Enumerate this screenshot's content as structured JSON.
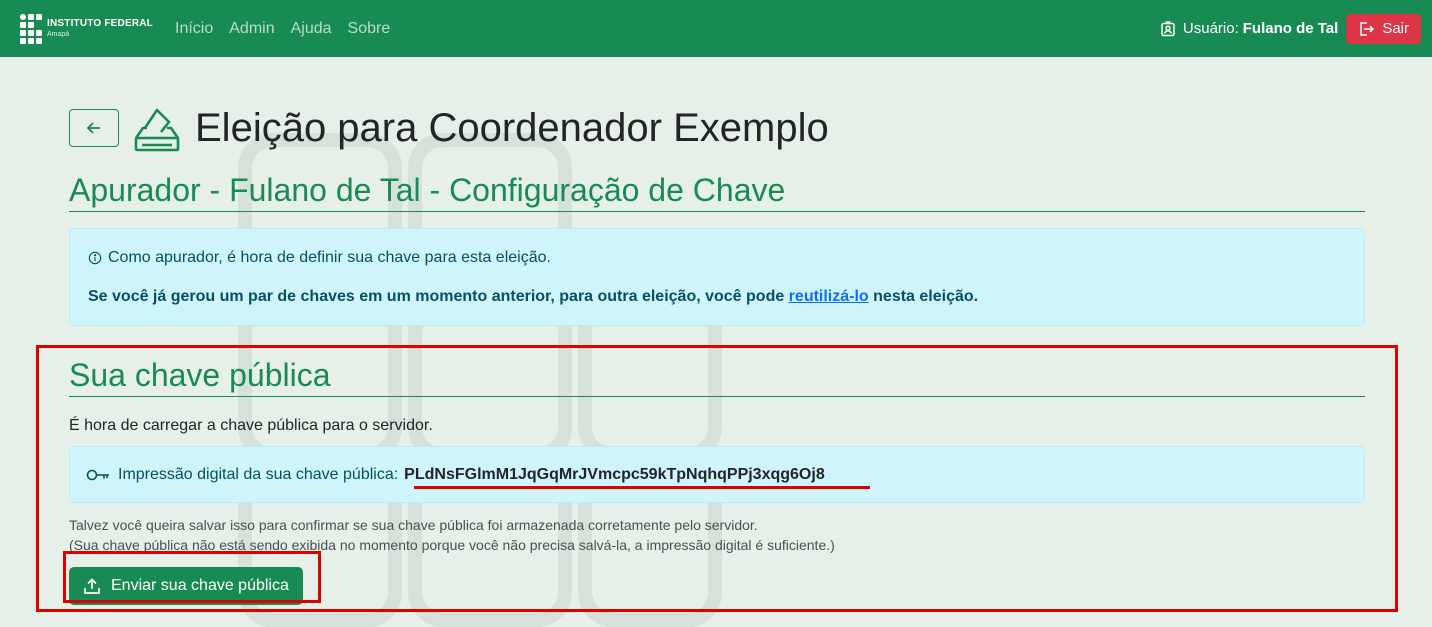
{
  "navbar": {
    "brand_name": "INSTITUTO FEDERAL",
    "brand_sub": "Amapá",
    "links": [
      "Início",
      "Admin",
      "Ajuda",
      "Sobre"
    ],
    "user_label": "Usuário:",
    "user_name": "Fulano de Tal",
    "logout_label": "Sair"
  },
  "page": {
    "title": "Eleição para Coordenador Exemplo",
    "subtitle": "Apurador - Fulano de Tal - Configuração de Chave"
  },
  "intro_alert": {
    "line1": "Como apurador, é hora de definir sua chave para esta eleição.",
    "line2_prefix": "Se você já gerou um par de chaves em um momento anterior, para outra eleição, você pode ",
    "line2_link": "reutilizá-lo",
    "line2_suffix": " nesta eleição."
  },
  "public_key": {
    "heading": "Sua chave pública",
    "lead": "É hora de carregar a chave pública para o servidor.",
    "fingerprint_label": "Impressão digital da sua chave pública:",
    "fingerprint_value": "PLdNsFGlmM1JqGqMrJVmcpc59kTpNqhqPPj3xqg6Oj8",
    "help_line1": "Talvez você queira salvar isso para confirmar se sua chave pública foi armazenada corretamente pelo servidor.",
    "help_line2": "(Sua chave pública não está sendo exibida no momento porque você não precisa salvá-la, a impressão digital é suficiente.)",
    "upload_button": "Enviar sua chave pública"
  },
  "colors": {
    "brand_green": "#188b54",
    "danger": "#dc3545",
    "info_bg": "#cff4fc",
    "annotation_red": "#e00000"
  }
}
